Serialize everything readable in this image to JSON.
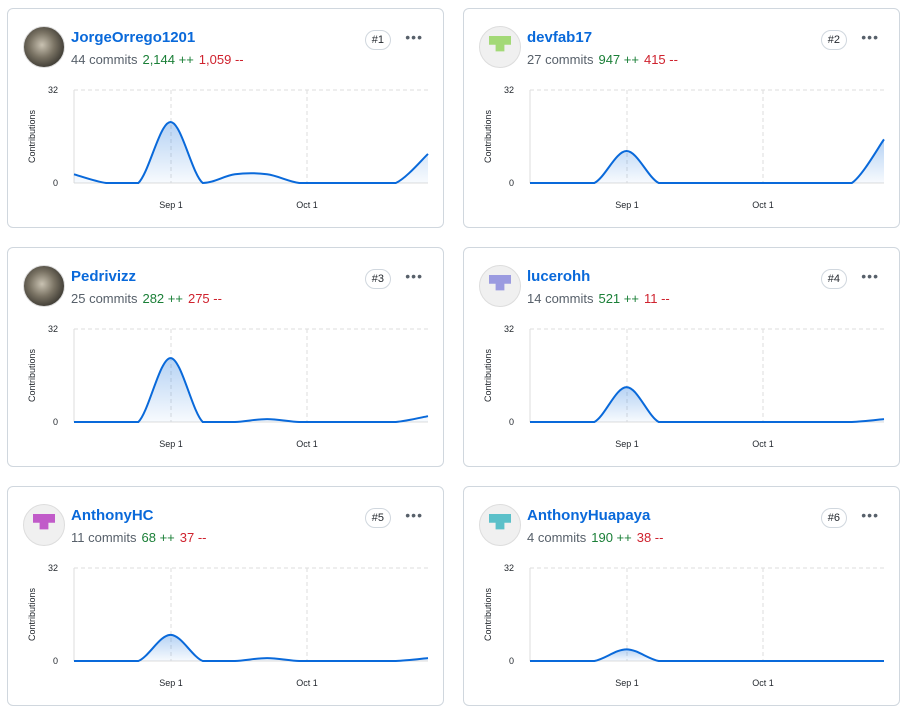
{
  "colors": {
    "line": "#0969da",
    "additions": "#1a7f37",
    "deletions": "#cf222e"
  },
  "contributors": [
    {
      "name": "JorgeOrrego1201",
      "commits": "44 commits",
      "additions": "2,144 ++",
      "deletions": "1,059 --",
      "rank": "#1",
      "avatar": "photo"
    },
    {
      "name": "devfab17",
      "commits": "27 commits",
      "additions": "947 ++",
      "deletions": "415 --",
      "rank": "#2",
      "avatar": "identicon-green"
    },
    {
      "name": "Pedrivizz",
      "commits": "25 commits",
      "additions": "282 ++",
      "deletions": "275 --",
      "rank": "#3",
      "avatar": "photo"
    },
    {
      "name": "lucerohh",
      "commits": "14 commits",
      "additions": "521 ++",
      "deletions": "11 --",
      "rank": "#4",
      "avatar": "identicon-purple"
    },
    {
      "name": "AnthonyHC",
      "commits": "11 commits",
      "additions": "68 ++",
      "deletions": "37 --",
      "rank": "#5",
      "avatar": "identicon-magenta"
    },
    {
      "name": "AnthonyHuapaya",
      "commits": "4 commits",
      "additions": "190 ++",
      "deletions": "38 --",
      "rank": "#6",
      "avatar": "identicon-teal"
    }
  ],
  "more_label": "•••",
  "chart_data": [
    {
      "type": "area",
      "ylabel": "Contributions",
      "ylim": [
        0,
        32
      ],
      "yticks": [
        "0",
        "32"
      ],
      "xticks": [
        "Sep 1",
        "Oct 1"
      ],
      "values": [
        3,
        0,
        0,
        21,
        0,
        3,
        3,
        0,
        0,
        0,
        0,
        10
      ]
    },
    {
      "type": "area",
      "ylabel": "Contributions",
      "ylim": [
        0,
        32
      ],
      "yticks": [
        "0",
        "32"
      ],
      "xticks": [
        "Sep 1",
        "Oct 1"
      ],
      "values": [
        0,
        0,
        0,
        11,
        0,
        0,
        0,
        0,
        0,
        0,
        0,
        15
      ]
    },
    {
      "type": "area",
      "ylabel": "Contributions",
      "ylim": [
        0,
        32
      ],
      "yticks": [
        "0",
        "32"
      ],
      "xticks": [
        "Sep 1",
        "Oct 1"
      ],
      "values": [
        0,
        0,
        0,
        22,
        0,
        0,
        1,
        0,
        0,
        0,
        0,
        2
      ]
    },
    {
      "type": "area",
      "ylabel": "Contributions",
      "ylim": [
        0,
        32
      ],
      "yticks": [
        "0",
        "32"
      ],
      "xticks": [
        "Sep 1",
        "Oct 1"
      ],
      "values": [
        0,
        0,
        0,
        12,
        0,
        0,
        0,
        0,
        0,
        0,
        0,
        1
      ]
    },
    {
      "type": "area",
      "ylabel": "Contributions",
      "ylim": [
        0,
        32
      ],
      "yticks": [
        "0",
        "32"
      ],
      "xticks": [
        "Sep 1",
        "Oct 1"
      ],
      "values": [
        0,
        0,
        0,
        9,
        0,
        0,
        1,
        0,
        0,
        0,
        0,
        1
      ]
    },
    {
      "type": "area",
      "ylabel": "Contributions",
      "ylim": [
        0,
        32
      ],
      "yticks": [
        "0",
        "32"
      ],
      "xticks": [
        "Sep 1",
        "Oct 1"
      ],
      "values": [
        0,
        0,
        0,
        4,
        0,
        0,
        0,
        0,
        0,
        0,
        0,
        0
      ]
    }
  ]
}
